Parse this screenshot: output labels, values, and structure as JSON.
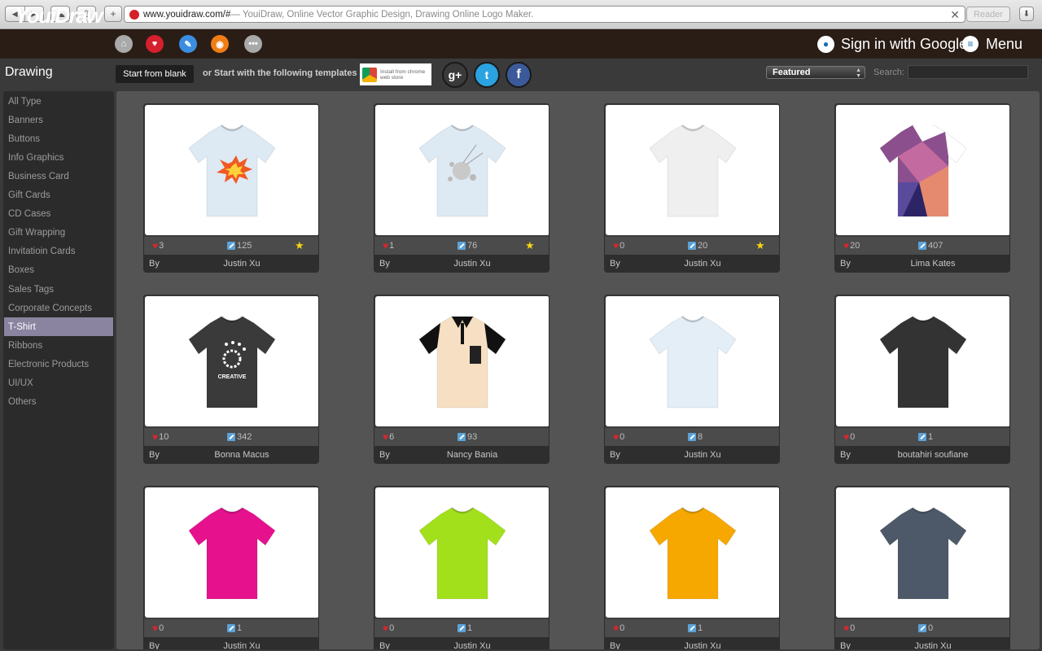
{
  "browser": {
    "url_domain": "www.youidraw.com/#",
    "url_title": " — YouiDraw, Online Vector Graphic Design, Drawing Online Logo Maker.",
    "reader_label": "Reader"
  },
  "header": {
    "logo": "YouiDraw",
    "signin_label": "Sign in with Google",
    "menu_label": "Menu"
  },
  "toolbar": {
    "section_title": "Drawing",
    "start_blank_label": "Start from blank",
    "templates_text": "or Start with the following templates",
    "chrome_store_text": "Install from chrome web store",
    "sort_value": "Featured",
    "search_label": "Search:",
    "search_value": ""
  },
  "sidebar": {
    "items": [
      {
        "label": "All Type"
      },
      {
        "label": "Banners"
      },
      {
        "label": "Buttons"
      },
      {
        "label": "Info Graphics"
      },
      {
        "label": "Business Card"
      },
      {
        "label": "Gift Cards"
      },
      {
        "label": "CD Cases"
      },
      {
        "label": "Gift Wrapping"
      },
      {
        "label": "Invitatioin Cards"
      },
      {
        "label": "Boxes"
      },
      {
        "label": "Sales Tags"
      },
      {
        "label": "Corporate Concepts"
      },
      {
        "label": "T-Shirt"
      },
      {
        "label": "Ribbons"
      },
      {
        "label": "Electronic Products"
      },
      {
        "label": "UI/UX"
      },
      {
        "label": "Others"
      }
    ],
    "active": "T-Shirt"
  },
  "cards": [
    {
      "likes": "3",
      "edits": "125",
      "featured": true,
      "by": "By",
      "author": "Justin Xu",
      "shirt_color": "#dde9f3",
      "design": "burst"
    },
    {
      "likes": "1",
      "edits": "76",
      "featured": true,
      "by": "By",
      "author": "Justin Xu",
      "shirt_color": "#dde9f3",
      "design": "splash"
    },
    {
      "likes": "0",
      "edits": "20",
      "featured": true,
      "by": "By",
      "author": "Justin Xu",
      "shirt_color": "#efefef",
      "design": "none"
    },
    {
      "likes": "20",
      "edits": "407",
      "featured": false,
      "by": "By",
      "author": "Lima Kates",
      "shirt_color": "#8c4f8e",
      "design": "poly"
    },
    {
      "likes": "10",
      "edits": "342",
      "featured": false,
      "by": "By",
      "author": "Bonna Macus",
      "shirt_color": "#3a3a3a",
      "design": "creative",
      "design_text": "CREATIVE"
    },
    {
      "likes": "6",
      "edits": "93",
      "featured": false,
      "by": "By",
      "author": "Nancy Bania",
      "shirt_color": "#f6dfc2",
      "design": "polo"
    },
    {
      "likes": "0",
      "edits": "8",
      "featured": false,
      "by": "By",
      "author": "Justin Xu",
      "shirt_color": "#e3eef7",
      "design": "none"
    },
    {
      "likes": "0",
      "edits": "1",
      "featured": false,
      "by": "By",
      "author": "boutahiri soufiane",
      "shirt_color": "#333333",
      "design": "none"
    },
    {
      "likes": "0",
      "edits": "1",
      "featured": false,
      "by": "By",
      "author": "Justin Xu",
      "shirt_color": "#e6118d",
      "design": "none"
    },
    {
      "likes": "0",
      "edits": "1",
      "featured": false,
      "by": "By",
      "author": "Justin Xu",
      "shirt_color": "#a3e01c",
      "design": "none"
    },
    {
      "likes": "0",
      "edits": "1",
      "featured": false,
      "by": "By",
      "author": "Justin Xu",
      "shirt_color": "#f6a800",
      "design": "none"
    },
    {
      "likes": "0",
      "edits": "0",
      "featured": false,
      "by": "By",
      "author": "Justin Xu",
      "shirt_color": "#4d5868",
      "design": "none"
    }
  ]
}
